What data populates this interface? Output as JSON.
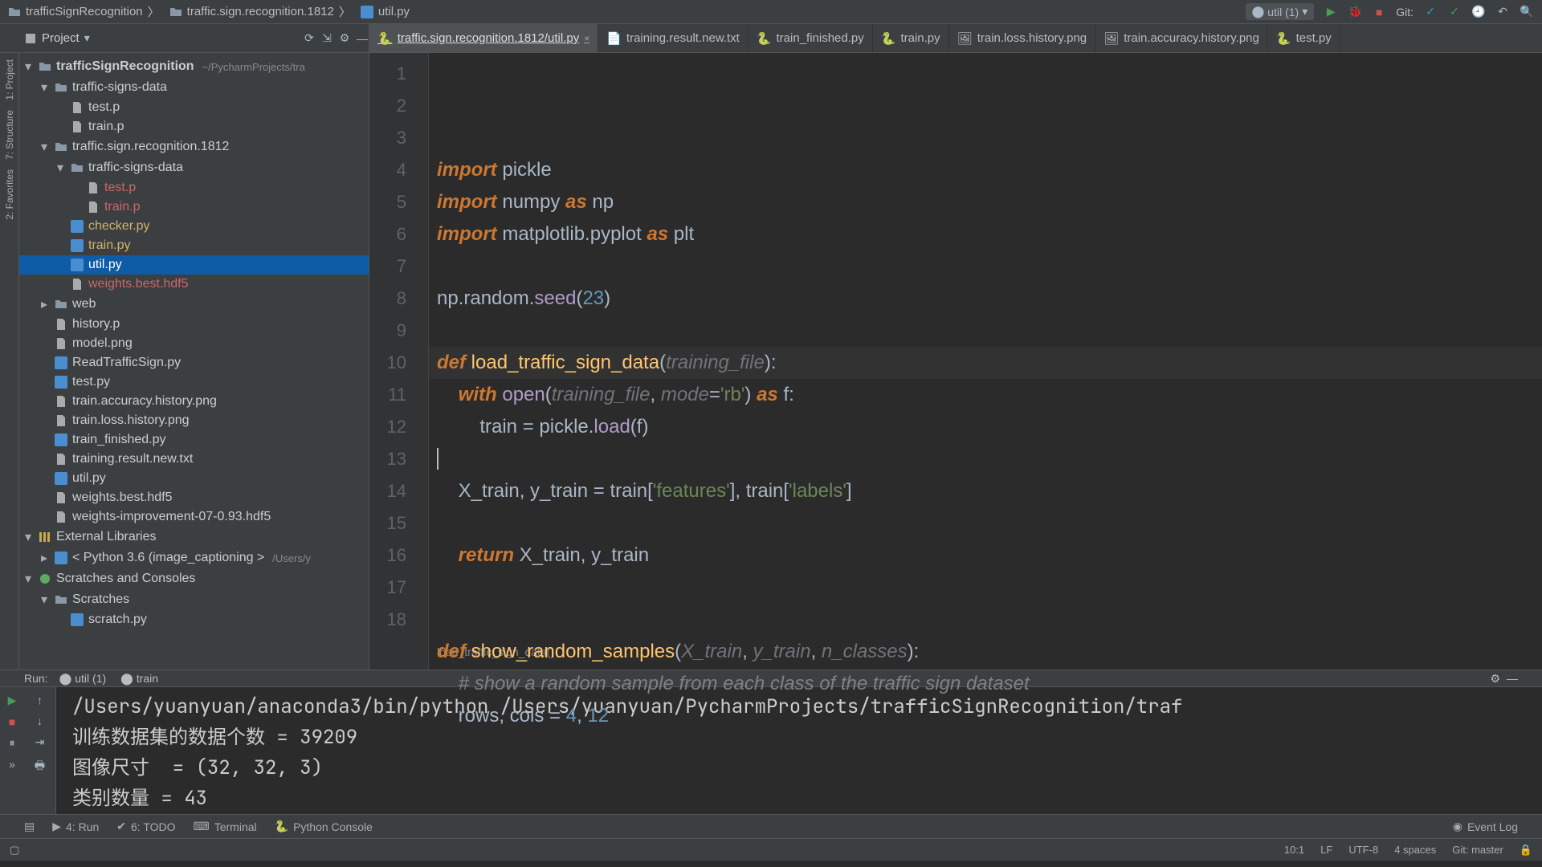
{
  "breadcrumb": {
    "project": "trafficSignRecognition",
    "folder": "traffic.sign.recognition.1812",
    "file": "util.py"
  },
  "toolbar": {
    "run_config": "util (1)",
    "git_label": "Git:"
  },
  "project_panel": {
    "title": "Project"
  },
  "editor_tabs": [
    {
      "label": "traffic.sign.recognition.1812/util.py",
      "active": true,
      "type": "py"
    },
    {
      "label": "training.result.new.txt",
      "type": "txt"
    },
    {
      "label": "train_finished.py",
      "type": "py"
    },
    {
      "label": "train.py",
      "type": "py"
    },
    {
      "label": "train.loss.history.png",
      "type": "img"
    },
    {
      "label": "train.accuracy.history.png",
      "type": "img"
    },
    {
      "label": "test.py",
      "type": "py"
    }
  ],
  "tree": {
    "root": "trafficSignRecognition",
    "root_path": "~/PycharmProjects/tra",
    "items": [
      {
        "indent": 1,
        "arrow": "▾",
        "icon": "folder",
        "name": "traffic-signs-data"
      },
      {
        "indent": 2,
        "icon": "file",
        "name": "test.p"
      },
      {
        "indent": 2,
        "icon": "file",
        "name": "train.p"
      },
      {
        "indent": 1,
        "arrow": "▾",
        "icon": "folder",
        "name": "traffic.sign.recognition.1812"
      },
      {
        "indent": 2,
        "arrow": "▾",
        "icon": "folder",
        "name": "traffic-signs-data"
      },
      {
        "indent": 3,
        "icon": "file",
        "name": "test.p",
        "cls": "red"
      },
      {
        "indent": 3,
        "icon": "file",
        "name": "train.p",
        "cls": "red"
      },
      {
        "indent": 2,
        "icon": "py",
        "name": "checker.py",
        "cls": "yellow"
      },
      {
        "indent": 2,
        "icon": "py",
        "name": "train.py",
        "cls": "yellow"
      },
      {
        "indent": 2,
        "icon": "py",
        "name": "util.py",
        "selected": true
      },
      {
        "indent": 2,
        "icon": "file",
        "name": "weights.best.hdf5",
        "cls": "red"
      },
      {
        "indent": 1,
        "arrow": "▸",
        "icon": "folder",
        "name": "web"
      },
      {
        "indent": 1,
        "icon": "file",
        "name": "history.p"
      },
      {
        "indent": 1,
        "icon": "file",
        "name": "model.png"
      },
      {
        "indent": 1,
        "icon": "py",
        "name": "ReadTrafficSign.py"
      },
      {
        "indent": 1,
        "icon": "py",
        "name": "test.py"
      },
      {
        "indent": 1,
        "icon": "file",
        "name": "train.accuracy.history.png"
      },
      {
        "indent": 1,
        "icon": "file",
        "name": "train.loss.history.png"
      },
      {
        "indent": 1,
        "icon": "py",
        "name": "train_finished.py"
      },
      {
        "indent": 1,
        "icon": "file",
        "name": "training.result.new.txt"
      },
      {
        "indent": 1,
        "icon": "py",
        "name": "util.py"
      },
      {
        "indent": 1,
        "icon": "file",
        "name": "weights.best.hdf5"
      },
      {
        "indent": 1,
        "icon": "file",
        "name": "weights-improvement-07-0.93.hdf5"
      },
      {
        "indent": 0,
        "arrow": "▾",
        "icon": "lib",
        "name": "External Libraries"
      },
      {
        "indent": 1,
        "arrow": "▸",
        "icon": "py",
        "name": "< Python 3.6 (image_captioning >",
        "path": "/Users/y"
      },
      {
        "indent": 0,
        "arrow": "▾",
        "icon": "scratch",
        "name": "Scratches and Consoles"
      },
      {
        "indent": 1,
        "arrow": "▾",
        "icon": "folder",
        "name": "Scratches"
      },
      {
        "indent": 2,
        "icon": "py",
        "name": "scratch.py"
      }
    ]
  },
  "code": {
    "lines": [
      {
        "n": 1,
        "html": "<span class='kw'>import</span> pickle"
      },
      {
        "n": 2,
        "html": "<span class='kw'>import</span> numpy <span class='kw'>as</span> np"
      },
      {
        "n": 3,
        "html": "<span class='kw'>import</span> matplotlib.pyplot <span class='kw'>as</span> plt"
      },
      {
        "n": 4,
        "html": ""
      },
      {
        "n": 5,
        "html": "np.random.<span class='call'>seed</span>(<span class='num'>23</span>)"
      },
      {
        "n": 6,
        "html": ""
      },
      {
        "n": 7,
        "html": "<span class='kw'>def</span> <span class='fn'>load_traffic_sign_data</span>(<span class='param'>training_file</span>):"
      },
      {
        "n": 8,
        "html": "    <span class='kw'>with</span> <span class='call'>open</span>(<span class='param'>training_file</span>, <span class='param'>mode</span>=<span class='str'>'rb'</span>) <span class='kw'>as</span> f:"
      },
      {
        "n": 9,
        "html": "        train = pickle.<span class='call'>load</span>(f)"
      },
      {
        "n": 10,
        "html": "<span class='caret'></span>"
      },
      {
        "n": 11,
        "html": "    X_train, y_train = train[<span class='str'>'features'</span>], train[<span class='str'>'labels'</span>]"
      },
      {
        "n": 12,
        "html": ""
      },
      {
        "n": 13,
        "html": "    <span class='kw'>return</span> X_train, y_train"
      },
      {
        "n": 14,
        "html": ""
      },
      {
        "n": 15,
        "html": ""
      },
      {
        "n": 16,
        "html": "<span class='kw'>def</span> <span class='fn'>show_random_samples</span>(<span class='param'>X_train</span>, <span class='param'>y_train</span>, <span class='param'>n_classes</span>):"
      },
      {
        "n": 17,
        "html": "    <span class='cmt'># show a random sample from each class of the traffic sign dataset</span>"
      },
      {
        "n": 18,
        "html": "    rows, cols = <span class='num'>4</span>, <span class='num'>12</span>"
      }
    ],
    "current_line_index": 9,
    "breadcrumb": "load_traffic_sign_data()"
  },
  "run": {
    "title": "Run:",
    "tabs": [
      {
        "label": "util (1)"
      },
      {
        "label": "train"
      }
    ],
    "output": [
      "/Users/yuanyuan/anaconda3/bin/python /Users/yuanyuan/PycharmProjects/trafficSignRecognition/traf",
      "训练数据集的数据个数 = 39209",
      "图像尺寸  = (32, 32, 3)",
      "类别数量 = 43"
    ]
  },
  "bottom_tabs": {
    "run": "4: Run",
    "todo": "6: TODO",
    "terminal": "Terminal",
    "pyconsole": "Python Console",
    "event_log": "Event Log"
  },
  "left_tool_tabs": {
    "project": "1: Project",
    "structure": "7: Structure",
    "favorites": "2: Favorites"
  },
  "status": {
    "pos": "10:1",
    "lf": "LF",
    "enc": "UTF-8",
    "indent": "4 spaces",
    "git": "Git: master"
  }
}
